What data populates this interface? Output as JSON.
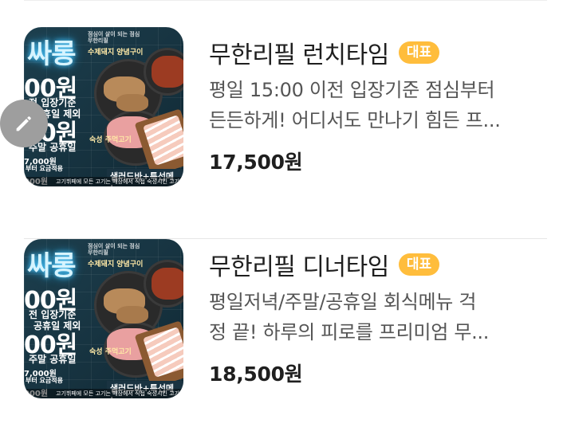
{
  "menu_items": [
    {
      "title": "무한리필 런치타임",
      "badge": "대표",
      "description_line1": "평일 15:00 이전 입장기준 점심부터",
      "description_line2": "든든하게! 어디서도 만나기 힘든 프...",
      "price": "17,500원",
      "thumbnail": {
        "brand": "싸롱",
        "price_a": "00원",
        "price_b": "00원",
        "note_a": "전 입장기준",
        "note_b": "공휴일 제외",
        "note_c": "주말 공휴일",
        "small_a": "7,000원",
        "small_b": "부터 요금적용",
        "small_c": "000원",
        "label_top": "점심이 살이 되는 점심 무한리필",
        "label_pork": "수제돼지 양념구이",
        "label_sliced": "숙성 주먹고기",
        "banner": "샐러드바+특선메뉴",
        "footer": "고기뷔페에 모든 고기는 매장에서 직접 숙성시킨 고기"
      }
    },
    {
      "title": "무한리필 디너타임",
      "badge": "대표",
      "description_line1": "평일저녁/주말/공휴일 회식메뉴 걱",
      "description_line2": "정 끝! 하루의 피로를 프리미엄 무...",
      "price": "18,500원",
      "thumbnail": {
        "brand": "싸롱",
        "price_a": "00원",
        "price_b": "00원",
        "note_a": "전 입장기준",
        "note_b": "공휴일 제외",
        "note_c": "주말 공휴일",
        "small_a": "7,000원",
        "small_b": "부터 요금적용",
        "small_c": "000원",
        "label_top": "점심이 살이 되는 점심 무한리필",
        "label_pork": "수제돼지 양념구이",
        "label_sliced": "숙성 주먹고기",
        "banner": "샐러드바+특선메뉴",
        "footer": "고기뷔페에 모든 고기는 매장에서 직접 숙성시킨 고기"
      }
    }
  ],
  "edit_button": {
    "icon": "pencil-icon"
  },
  "colors": {
    "badge": "#ffbd3c",
    "title": "#1f1f1f",
    "description": "#555555",
    "divider": "#e6e6e6",
    "fab": "#9e9e9e"
  }
}
